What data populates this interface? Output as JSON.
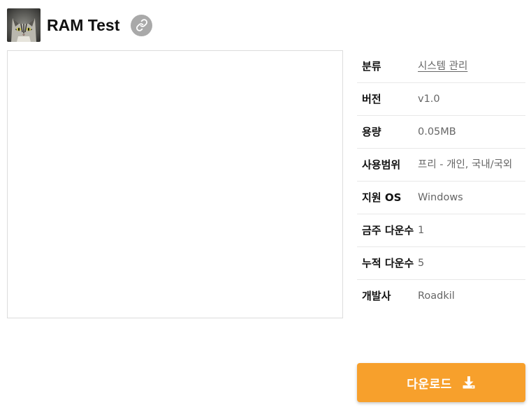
{
  "app": {
    "title": "RAM Test",
    "icon": "cat-thumbnail",
    "link_icon": "link-icon"
  },
  "info": {
    "rows": [
      {
        "label": "분류",
        "value": "시스템 관리"
      },
      {
        "label": "버전",
        "value": "v1.0"
      },
      {
        "label": "용량",
        "value": "0.05MB"
      },
      {
        "label": "사용범위",
        "value": "프리 - 개인, 국내/국외"
      },
      {
        "label": "지원 OS",
        "value": "Windows"
      },
      {
        "label": "금주 다운수",
        "value": "1"
      },
      {
        "label": "누적 다운수",
        "value": "5"
      },
      {
        "label": "개발사",
        "value": "Roadkil"
      }
    ]
  },
  "download": {
    "label": "다운로드",
    "icon": "download-icon",
    "color": "#f7a02c"
  }
}
